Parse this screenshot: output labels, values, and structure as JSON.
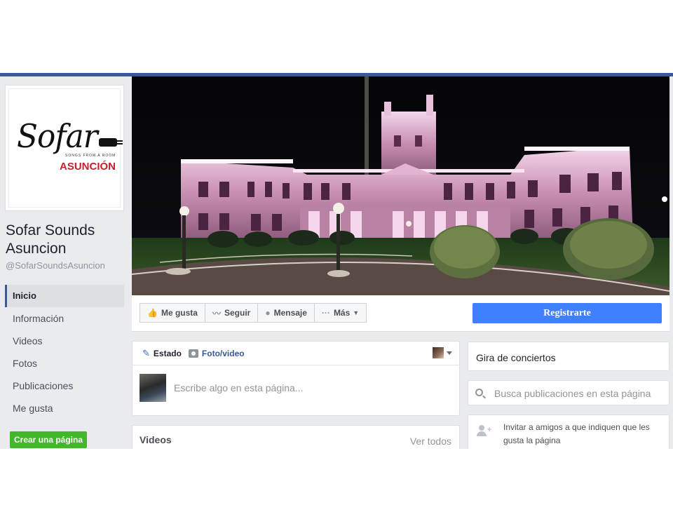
{
  "page": {
    "name": "Sofar Sounds Asuncion",
    "handle": "@SofarSoundsAsuncion",
    "logo": {
      "word": "Sofar",
      "sub": "SONGS FROM A ROOM",
      "city": "ASUNCIÓN"
    }
  },
  "sidebar": {
    "items": [
      {
        "label": "Inicio",
        "active": true
      },
      {
        "label": "Información"
      },
      {
        "label": "Videos"
      },
      {
        "label": "Fotos"
      },
      {
        "label": "Publicaciones"
      },
      {
        "label": "Me gusta"
      }
    ],
    "create_page": "Crear una página"
  },
  "actions": {
    "like": "Me gusta",
    "follow": "Seguir",
    "message": "Mensaje",
    "more": "Más",
    "register": "Registrarte"
  },
  "composer": {
    "tab_status": "Estado",
    "tab_photo": "Foto/video",
    "placeholder": "Escribe algo en esta página..."
  },
  "videos": {
    "title": "Videos",
    "see_all": "Ver todos"
  },
  "right": {
    "tour": "Gira de conciertos",
    "search_placeholder": "Busca publicaciones en esta página",
    "invite": "Invitar a amigos a que indiquen que les gusta la página"
  },
  "colors": {
    "brand": "#3b5998",
    "register": "#4080ff",
    "create": "#42b72a",
    "logo_red": "#c4202d"
  }
}
